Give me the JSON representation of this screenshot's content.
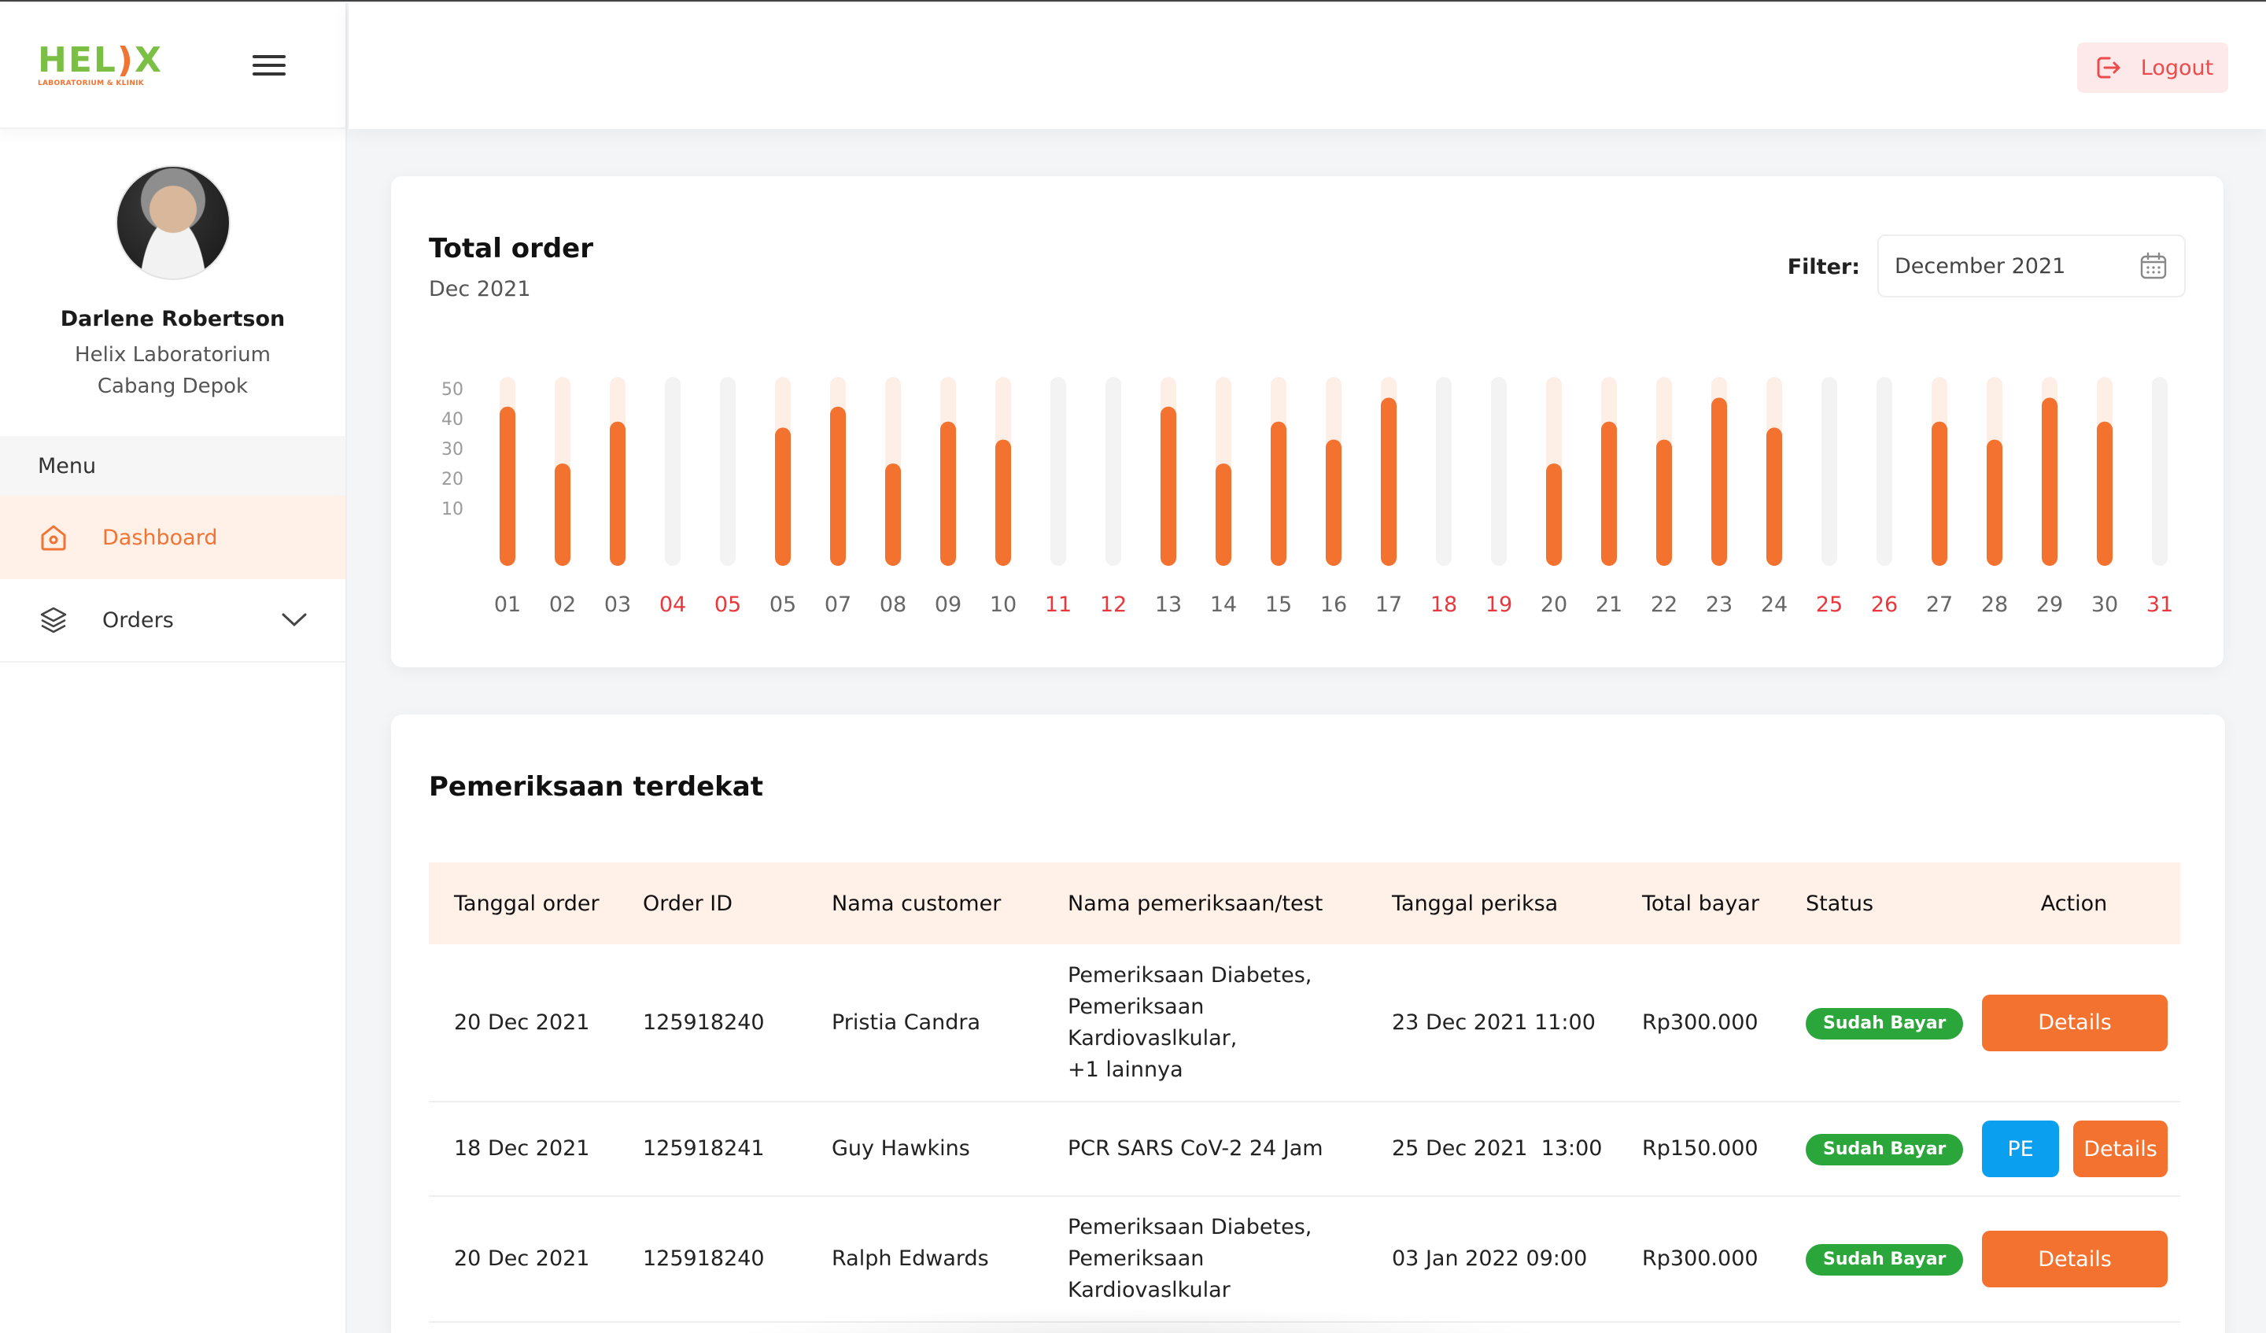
{
  "brand": {
    "name": "HELIX",
    "subtitle": "LABORATORIUM & KLINIK"
  },
  "profile": {
    "name": "Darlene Robertson",
    "org": "Helix Laboratorium",
    "branch": "Cabang Depok"
  },
  "menu": {
    "title": "Menu",
    "items": [
      {
        "label": "Dashboard",
        "icon": "home-icon",
        "active": true
      },
      {
        "label": "Orders",
        "icon": "layers-icon",
        "expandable": true
      }
    ]
  },
  "topbar": {
    "logout_label": "Logout"
  },
  "chart": {
    "title": "Total order",
    "subtitle": "Dec 2021",
    "filter_label": "Filter:",
    "filter_value": "December 2021"
  },
  "chart_data": {
    "type": "bar",
    "title": "Total order",
    "subtitle": "Dec 2021",
    "ylim": [
      0,
      50
    ],
    "yticks": [
      50,
      40,
      30,
      20,
      10
    ],
    "categories": [
      "01",
      "02",
      "03",
      "04",
      "05",
      "05",
      "07",
      "08",
      "09",
      "10",
      "11",
      "12",
      "13",
      "14",
      "15",
      "16",
      "17",
      "18",
      "19",
      "20",
      "21",
      "22",
      "23",
      "24",
      "25",
      "26",
      "27",
      "28",
      "29",
      "30",
      "31"
    ],
    "weekend": [
      false,
      false,
      false,
      true,
      true,
      false,
      false,
      false,
      false,
      false,
      true,
      true,
      false,
      false,
      false,
      false,
      false,
      true,
      true,
      false,
      false,
      false,
      false,
      false,
      true,
      true,
      false,
      false,
      false,
      false,
      true
    ],
    "values": [
      44,
      25,
      39,
      0,
      0,
      37,
      44,
      25,
      39,
      33,
      0,
      0,
      44,
      25,
      39,
      33,
      47,
      0,
      0,
      25,
      39,
      33,
      47,
      37,
      0,
      0,
      39,
      33,
      47,
      39,
      0
    ],
    "colors": {
      "bar": "#f47230",
      "track_active": "#fdefe6",
      "track_empty": "#f3f3f3",
      "weekend_label": "#e8383d",
      "label": "#666666"
    }
  },
  "table": {
    "title": "Pemeriksaan terdekat",
    "headers": [
      "Tanggal order",
      "Order ID",
      "Nama customer",
      "Nama pemeriksaan/test",
      "Tanggal periksa",
      "Total bayar",
      "Status",
      "Action"
    ],
    "rows": [
      {
        "order_date": "20 Dec 2021",
        "order_id": "125918240",
        "customer": "Pristia Candra",
        "test_lines": [
          "Pemeriksaan Diabetes,",
          "Pemeriksaan Kardiovaslkular,",
          "+1 lainnya"
        ],
        "exam_date": "23 Dec 2021 11:00",
        "total": "Rp300.000",
        "status": "Sudah Bayar",
        "actions": [
          "Details"
        ]
      },
      {
        "order_date": "18 Dec 2021",
        "order_id": "125918241",
        "customer": "Guy Hawkins",
        "test_lines": [
          "PCR SARS CoV-2 24 Jam"
        ],
        "exam_date": "25 Dec 2021  13:00",
        "total": "Rp150.000",
        "status": "Sudah Bayar",
        "actions": [
          "PE",
          "Details"
        ]
      },
      {
        "order_date": "20 Dec 2021",
        "order_id": "125918240",
        "customer": "Ralph Edwards",
        "test_lines": [
          "Pemeriksaan Diabetes,",
          "Pemeriksaan Kardiovaslkular"
        ],
        "exam_date": "03 Jan 2022 09:00",
        "total": "Rp300.000",
        "status": "Sudah Bayar",
        "actions": [
          "Details"
        ]
      }
    ]
  }
}
